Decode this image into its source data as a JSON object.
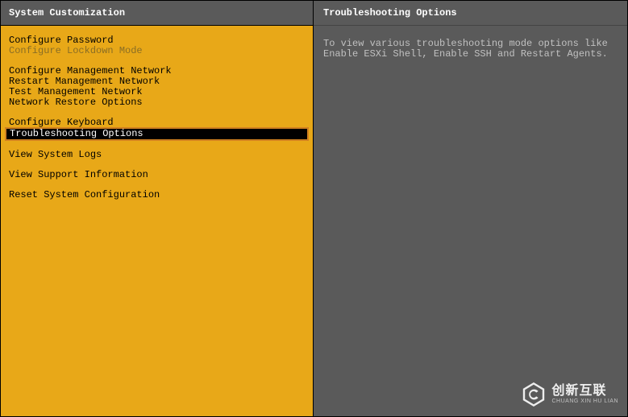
{
  "left": {
    "title": "System Customization",
    "groups": [
      [
        {
          "label": "Configure Password",
          "state": "normal"
        },
        {
          "label": "Configure Lockdown Mode",
          "state": "disabled"
        }
      ],
      [
        {
          "label": "Configure Management Network",
          "state": "normal"
        },
        {
          "label": "Restart Management Network",
          "state": "normal"
        },
        {
          "label": "Test Management Network",
          "state": "normal"
        },
        {
          "label": "Network Restore Options",
          "state": "normal"
        }
      ],
      [
        {
          "label": "Configure Keyboard",
          "state": "normal"
        },
        {
          "label": "Troubleshooting Options",
          "state": "selected"
        }
      ],
      [
        {
          "label": "View System Logs",
          "state": "normal"
        }
      ],
      [
        {
          "label": "View Support Information",
          "state": "normal"
        }
      ],
      [
        {
          "label": "Reset System Configuration",
          "state": "normal"
        }
      ]
    ]
  },
  "right": {
    "title": "Troubleshooting Options",
    "description": "To view various troubleshooting mode options like Enable ESXi Shell, Enable SSH and Restart Agents."
  },
  "watermark": {
    "cn": "创新互联",
    "en": "CHUANG XIN HU LIAN"
  }
}
